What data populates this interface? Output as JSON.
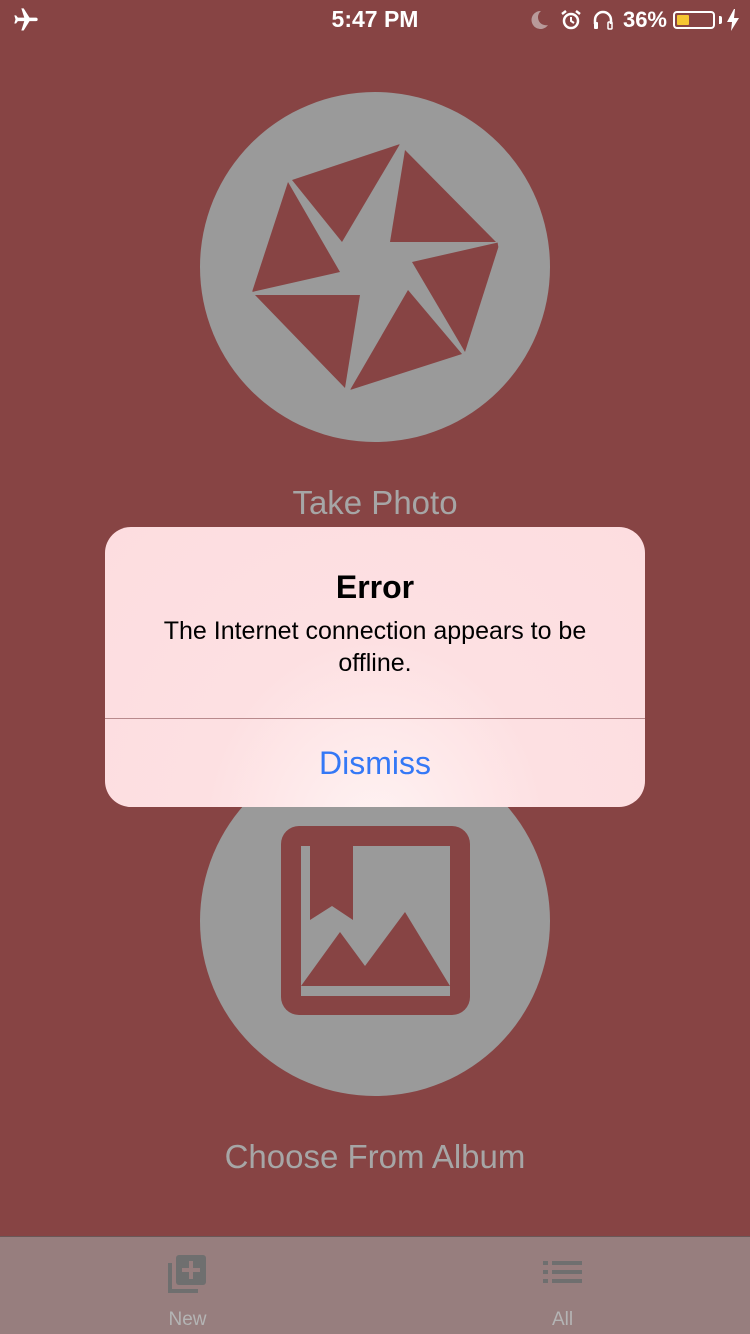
{
  "status_bar": {
    "time": "5:47 PM",
    "battery_percent": "36%",
    "battery_level": 0.36,
    "battery_color": "#f5c632",
    "icons": [
      "airplane-icon",
      "moon-icon",
      "alarm-icon",
      "headphones-icon",
      "battery-icon",
      "charging-bolt-icon"
    ]
  },
  "main": {
    "take_photo_label": "Take Photo",
    "choose_album_label": "Choose From Album",
    "take_photo_icon": "camera-aperture-icon",
    "choose_album_icon": "photo-album-icon"
  },
  "alert": {
    "title": "Error",
    "message": "The Internet connection appears to be offline.",
    "dismiss_label": "Dismiss",
    "button_color": "#3478f6"
  },
  "tab_bar": {
    "tabs": [
      {
        "label": "New",
        "icon": "add-photo-icon"
      },
      {
        "label": "All",
        "icon": "list-icon"
      }
    ]
  },
  "colors": {
    "background": "#874444",
    "circle": "#9a9a9a",
    "label": "#a6a6a6",
    "tab_bar": "#977e7e"
  }
}
